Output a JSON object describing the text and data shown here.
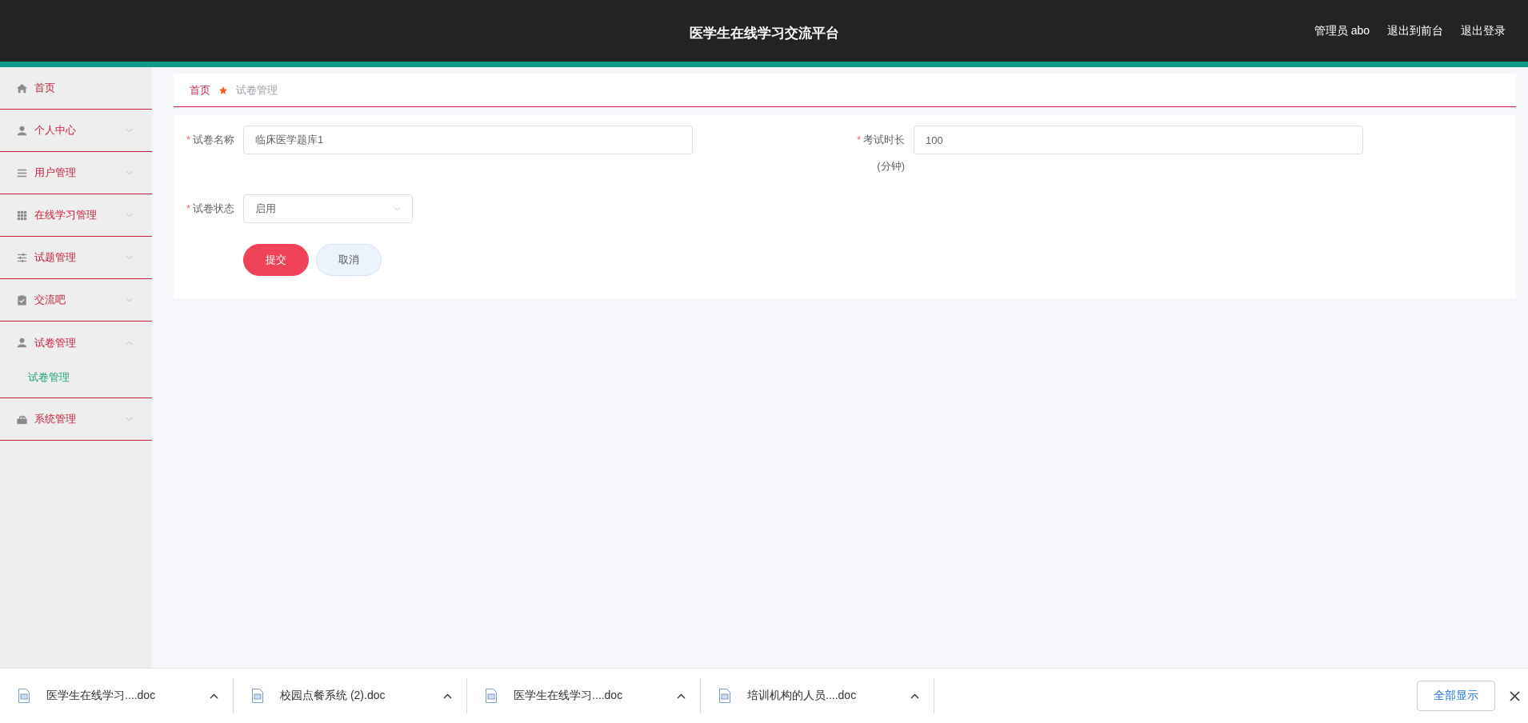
{
  "header": {
    "title": "医学生在线学习交流平台",
    "links": [
      "管理员 abo",
      "退出到前台",
      "退出登录"
    ]
  },
  "sidebar": {
    "items": [
      {
        "label": "首页"
      },
      {
        "label": "个人中心",
        "expanded": false
      },
      {
        "label": "用户管理",
        "expanded": false
      },
      {
        "label": "在线学习管理",
        "expanded": false
      },
      {
        "label": "试题管理",
        "expanded": false
      },
      {
        "label": "交流吧",
        "expanded": false
      },
      {
        "label": "试卷管理",
        "expanded": true,
        "children": [
          {
            "label": "试卷管理",
            "selected": true
          }
        ]
      },
      {
        "label": "系统管理",
        "expanded": false
      }
    ]
  },
  "breadcrumb": [
    "首页",
    "试卷管理"
  ],
  "form": {
    "fields": [
      {
        "kind": "text",
        "label": "试卷名称",
        "required_mark": "*",
        "value": "临床医学题库1"
      },
      {
        "kind": "text",
        "label": "考试时长",
        "unit": "(分钟)",
        "required_mark": "*",
        "value": "100"
      },
      {
        "kind": "select",
        "label": "试卷状态",
        "required_mark": "*",
        "value": "启用"
      }
    ],
    "buttons": [
      {
        "kind": "primary",
        "label": "提交"
      },
      {
        "kind": "secondary",
        "label": "取消"
      }
    ]
  },
  "downloads": {
    "files": [
      "医学生在线学习....doc",
      "校园点餐系统 (2).doc",
      "医学生在线学习....doc",
      "培训机构的人员....doc"
    ],
    "show_all": "全部显示"
  }
}
